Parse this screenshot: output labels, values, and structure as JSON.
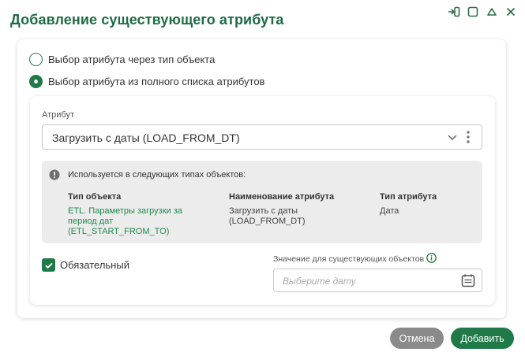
{
  "dialog": {
    "title": "Добавление существующего атрибута"
  },
  "window_controls": {
    "icons": [
      "dock-icon",
      "maximize-icon",
      "collapse-icon",
      "close-icon"
    ]
  },
  "selection_mode": {
    "options": [
      {
        "label": "Выбор атрибута через тип объекта",
        "selected": false
      },
      {
        "label": "Выбор атрибута из полного списка атрибутов",
        "selected": true
      }
    ]
  },
  "attribute": {
    "label": "Атрибут",
    "value": "Загрузить с даты (LOAD_FROM_DT)"
  },
  "usage": {
    "header": "Используется в следующих типах объектов:",
    "columns": [
      "Тип объекта",
      "Наименование атрибута",
      "Тип атрибута"
    ],
    "rows": [
      {
        "object_type": "ETL. Параметры загрузки за период дат (ETL_START_FROM_TO)",
        "object_type_line1": "ETL. Параметры загрузки за",
        "object_type_line2": "период дат",
        "object_type_line3": "(ETL_START_FROM_TO)",
        "attr_name_line1": "Загрузить с даты",
        "attr_name_line2": "(LOAD_FROM_DT)",
        "attr_type": "Дата"
      }
    ]
  },
  "required": {
    "label": "Обязательный",
    "checked": true
  },
  "existing_value": {
    "label": "Значение для существующих объектов",
    "placeholder": "Выберите дату"
  },
  "buttons": {
    "cancel": "Отмена",
    "add": "Добавить"
  },
  "colors": {
    "accent": "#1f7a47",
    "title": "#1f6b45",
    "link": "#1f8a4c",
    "cancel_bg": "#8a8a8a",
    "info_bg": "#ececec"
  }
}
